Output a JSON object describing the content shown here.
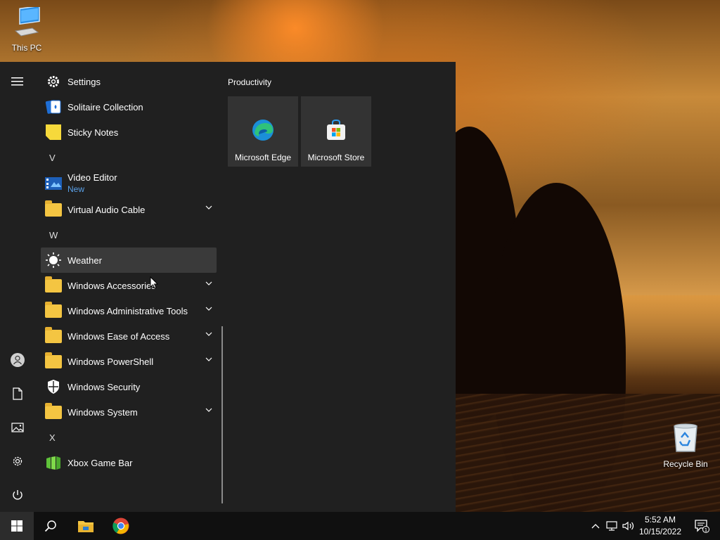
{
  "desktop": {
    "icons": [
      {
        "label": "This PC",
        "icon": "computer-icon"
      },
      {
        "label": "Recycle Bin",
        "icon": "recycle-bin-icon"
      }
    ]
  },
  "start_menu": {
    "rail": [
      {
        "icon": "hamburger-menu-icon"
      },
      {
        "icon": "user-account-icon"
      },
      {
        "icon": "documents-icon"
      },
      {
        "icon": "pictures-icon"
      },
      {
        "icon": "settings-gear-icon"
      },
      {
        "icon": "power-icon"
      }
    ],
    "apps": {
      "settings": "Settings",
      "solitaire": "Solitaire Collection",
      "sticky_notes": "Sticky Notes",
      "letter_v": "V",
      "video_editor": "Video Editor",
      "video_editor_badge": "New",
      "virtual_audio_cable": "Virtual Audio Cable",
      "letter_w": "W",
      "weather": "Weather",
      "win_accessories": "Windows Accessories",
      "win_admin_tools": "Windows Administrative Tools",
      "win_ease": "Windows Ease of Access",
      "win_powershell": "Windows PowerShell",
      "win_security": "Windows Security",
      "win_system": "Windows System",
      "letter_x": "X",
      "xbox_game_bar": "Xbox Game Bar"
    },
    "tiles": {
      "group_title": "Productivity",
      "edge": "Microsoft Edge",
      "store": "Microsoft Store"
    }
  },
  "taskbar": {
    "buttons": [
      {
        "icon": "windows-start-icon"
      },
      {
        "icon": "search-icon"
      },
      {
        "icon": "file-explorer-icon"
      },
      {
        "icon": "chrome-icon"
      }
    ],
    "tray": {
      "icons": [
        "chevron-up-icon",
        "network-icon",
        "volume-icon"
      ],
      "time": "5:52 AM",
      "date": "10/15/2022",
      "notification_count": "1"
    }
  },
  "colors": {
    "menu_bg": "#202020",
    "taskbar_bg": "#101010",
    "accent_new": "#5aa0e8",
    "folder_yellow": "#f4c542"
  }
}
